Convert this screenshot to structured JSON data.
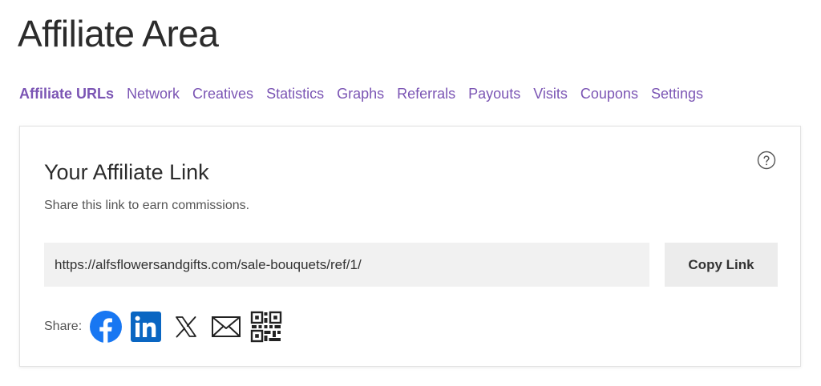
{
  "page": {
    "title": "Affiliate Area"
  },
  "tabs": [
    {
      "label": "Affiliate URLs",
      "active": true
    },
    {
      "label": "Network",
      "active": false
    },
    {
      "label": "Creatives",
      "active": false
    },
    {
      "label": "Statistics",
      "active": false
    },
    {
      "label": "Graphs",
      "active": false
    },
    {
      "label": "Referrals",
      "active": false
    },
    {
      "label": "Payouts",
      "active": false
    },
    {
      "label": "Visits",
      "active": false
    },
    {
      "label": "Coupons",
      "active": false
    },
    {
      "label": "Settings",
      "active": false
    }
  ],
  "card": {
    "title": "Your Affiliate Link",
    "description": "Share this link to earn commissions.",
    "help_icon": "question-circle-icon",
    "url_value": "https://alfsflowersandgifts.com/sale-bouquets/ref/1/",
    "copy_label": "Copy Link",
    "share_label": "Share:",
    "share_icons": [
      "facebook-icon",
      "linkedin-icon",
      "x-icon",
      "email-icon",
      "qr-code-icon"
    ]
  },
  "colors": {
    "accent": "#7b55b4",
    "facebook": "#1877f2",
    "linkedin": "#0a66c2"
  }
}
